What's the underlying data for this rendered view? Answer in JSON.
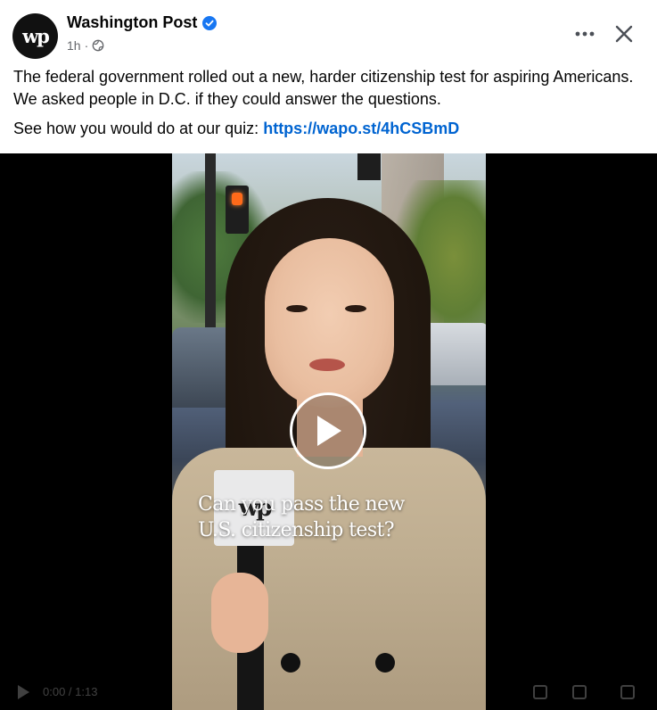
{
  "post": {
    "page_name": "Washington Post",
    "avatar_text": "wp",
    "timestamp": "1h",
    "separator": "·",
    "caption": "The federal government rolled out a new, harder citizenship test for aspiring Americans. We asked people in D.C. if they could answer the questions.",
    "quiz_prefix": "See how you would do at our quiz:",
    "quiz_link": "https://wapo.st/4hCSBmD"
  },
  "video": {
    "overlay_line1": "Can you pass the new",
    "overlay_line2": "U.S. citizenship test?",
    "mic_logo": "wp",
    "time": "0:00 / 1:13"
  },
  "colors": {
    "link": "#0064d1",
    "verified": "#1877f2",
    "meta": "#65676b"
  },
  "icons": [
    "verified-badge-icon",
    "globe-icon",
    "more-icon",
    "close-icon",
    "play-icon"
  ]
}
